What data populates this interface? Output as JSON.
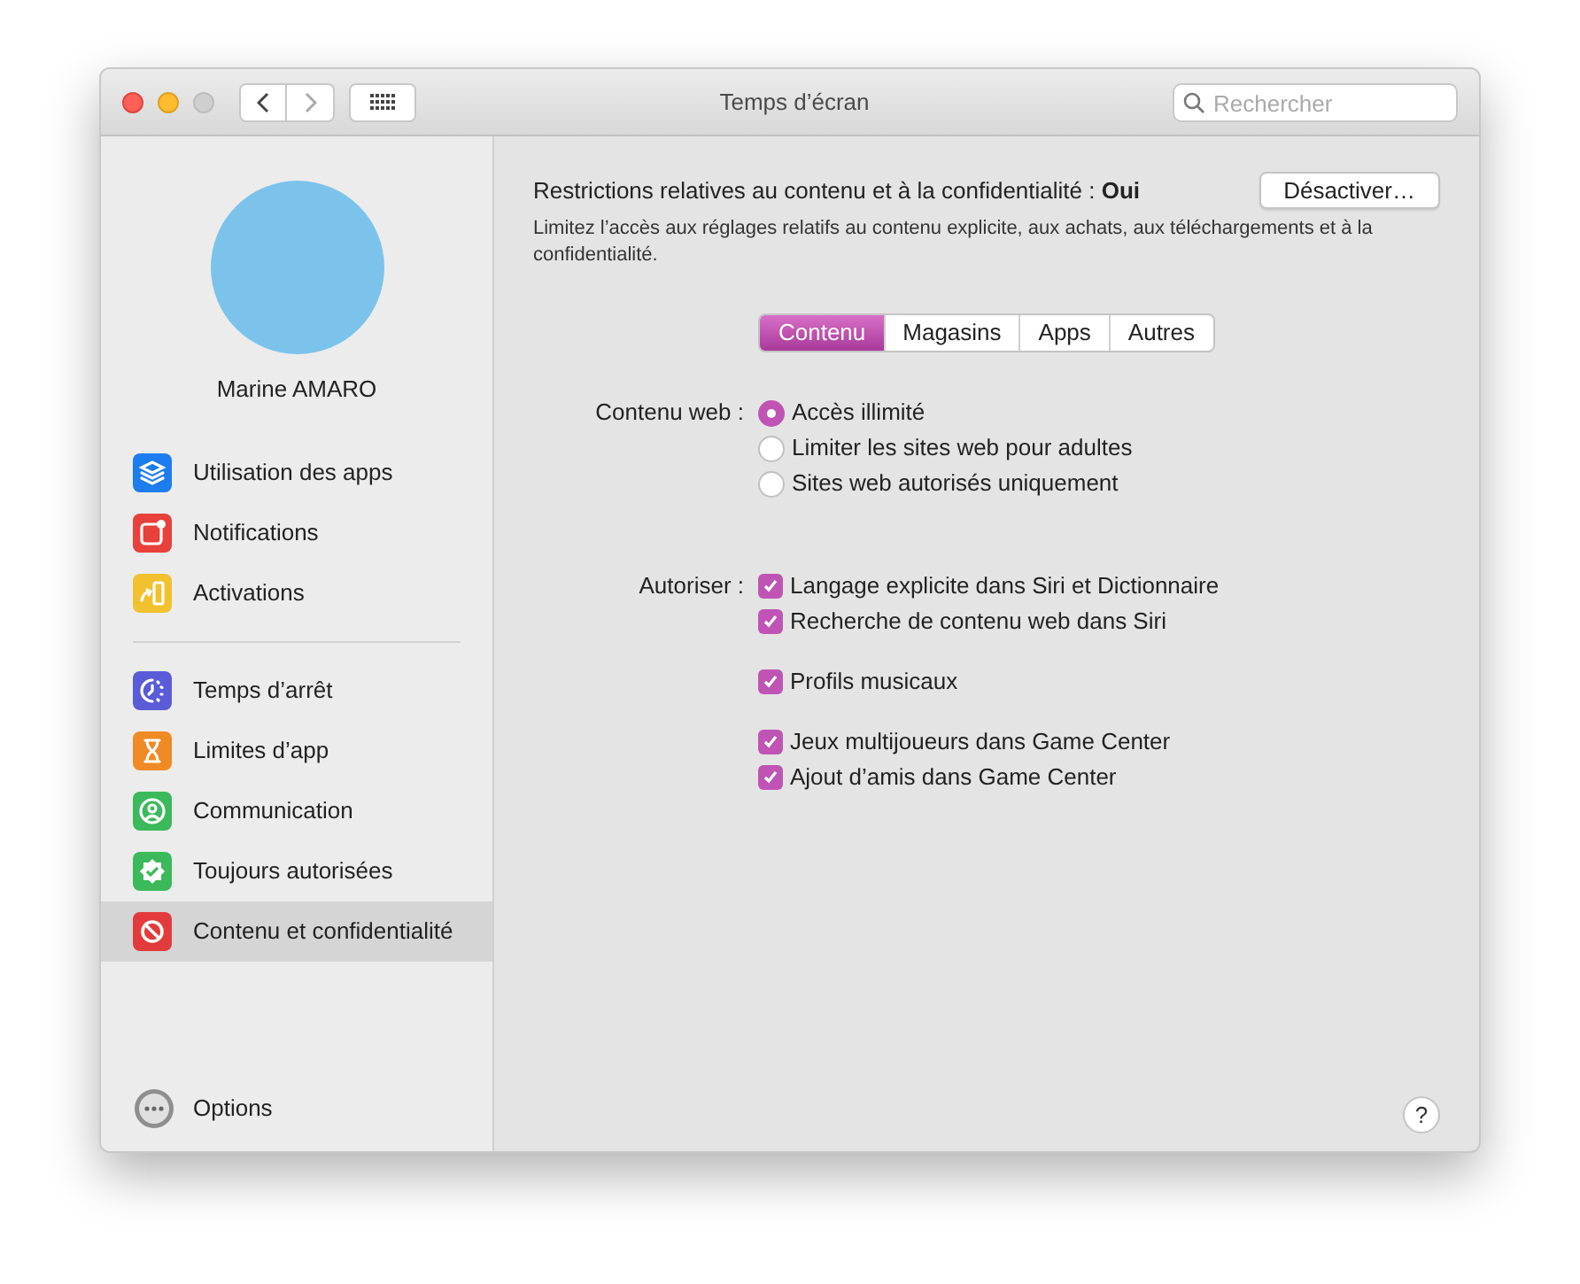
{
  "window": {
    "title": "Temps d’écran"
  },
  "search": {
    "placeholder": "Rechercher"
  },
  "user": {
    "name": "Marine AMARO"
  },
  "sidebar": {
    "groups": [
      [
        {
          "label": "Utilisation des apps",
          "kind": "layers",
          "color": "#1c7cf0",
          "selected": false
        },
        {
          "label": "Notifications",
          "kind": "notification",
          "color": "#e8403a",
          "selected": false
        },
        {
          "label": "Activations",
          "kind": "pickup",
          "color": "#f2c12e",
          "selected": false
        }
      ],
      [
        {
          "label": "Temps d’arrêt",
          "kind": "downtime",
          "color": "#5b5bd8",
          "selected": false
        },
        {
          "label": "Limites d’app",
          "kind": "hourglass",
          "color": "#f08a24",
          "selected": false
        },
        {
          "label": "Communication",
          "kind": "person",
          "color": "#3cb95a",
          "selected": false
        },
        {
          "label": "Toujours autorisées",
          "kind": "check",
          "color": "#3cb95a",
          "selected": false
        },
        {
          "label": "Contenu et confidentialité",
          "kind": "forbidden",
          "color": "#e33b3b",
          "selected": true
        }
      ]
    ],
    "options": "Options"
  },
  "header": {
    "text": "Restrictions relatives au contenu et à la confidentialité : **Oui**",
    "button": "Désactiver…",
    "description": "Limitez l’accès aux réglages relatifs au contenu explicite, aux achats, aux téléchargements et à la confidentialité."
  },
  "tabs": [
    {
      "label": "Contenu",
      "selected": true
    },
    {
      "label": "Magasins",
      "selected": false
    },
    {
      "label": "Apps",
      "selected": false
    },
    {
      "label": "Autres",
      "selected": false
    }
  ],
  "web_content": {
    "label": "Contenu web :",
    "options": [
      {
        "label": "Accès illimité",
        "selected": true
      },
      {
        "label": "Limiter les sites web pour adultes",
        "selected": false
      },
      {
        "label": "Sites web autorisés uniquement",
        "selected": false
      }
    ]
  },
  "allow": {
    "label": "Autoriser :",
    "groups": [
      [
        {
          "label": "Langage explicite dans Siri et Dictionnaire",
          "checked": true
        },
        {
          "label": "Recherche de contenu web dans Siri",
          "checked": true
        }
      ],
      [
        {
          "label": "Profils musicaux",
          "checked": true
        }
      ],
      [
        {
          "label": "Jeux multijoueurs dans Game Center",
          "checked": true
        },
        {
          "label": "Ajout d’amis dans Game Center",
          "checked": true
        }
      ]
    ]
  },
  "help": "?"
}
